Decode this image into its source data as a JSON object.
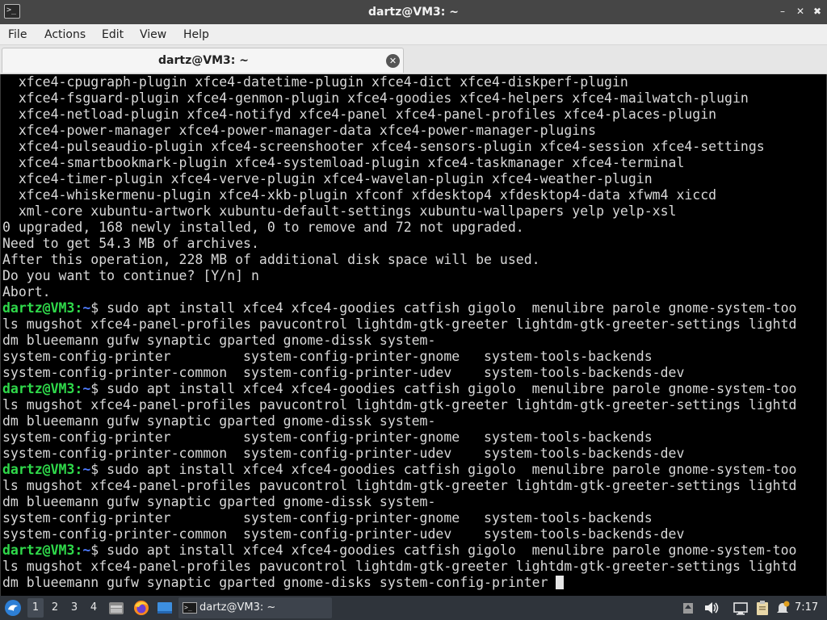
{
  "window": {
    "title": "dartz@VM3: ~"
  },
  "menubar": {
    "items": [
      "File",
      "Actions",
      "Edit",
      "View",
      "Help"
    ]
  },
  "tab": {
    "label": "dartz@VM3: ~"
  },
  "terminal": {
    "lines": [
      {
        "text": "  xfce4-cpugraph-plugin xfce4-datetime-plugin xfce4-dict xfce4-diskperf-plugin"
      },
      {
        "text": "  xfce4-fsguard-plugin xfce4-genmon-plugin xfce4-goodies xfce4-helpers xfce4-mailwatch-plugin"
      },
      {
        "text": "  xfce4-netload-plugin xfce4-notifyd xfce4-panel xfce4-panel-profiles xfce4-places-plugin"
      },
      {
        "text": "  xfce4-power-manager xfce4-power-manager-data xfce4-power-manager-plugins"
      },
      {
        "text": "  xfce4-pulseaudio-plugin xfce4-screenshooter xfce4-sensors-plugin xfce4-session xfce4-settings"
      },
      {
        "text": "  xfce4-smartbookmark-plugin xfce4-systemload-plugin xfce4-taskmanager xfce4-terminal"
      },
      {
        "text": "  xfce4-timer-plugin xfce4-verve-plugin xfce4-wavelan-plugin xfce4-weather-plugin"
      },
      {
        "text": "  xfce4-whiskermenu-plugin xfce4-xkb-plugin xfconf xfdesktop4 xfdesktop4-data xfwm4 xiccd"
      },
      {
        "text": "  xml-core xubuntu-artwork xubuntu-default-settings xubuntu-wallpapers yelp yelp-xsl"
      },
      {
        "text": "0 upgraded, 168 newly installed, 0 to remove and 72 not upgraded."
      },
      {
        "text": "Need to get 54.3 MB of archives."
      },
      {
        "text": "After this operation, 228 MB of additional disk space will be used."
      },
      {
        "text": "Do you want to continue? [Y/n] n"
      },
      {
        "text": "Abort."
      },
      {
        "user": "dartz@VM3",
        "path": "~",
        "text": " sudo apt install xfce4 xfce4-goodies catfish gigolo  menulibre parole gnome-system-too"
      },
      {
        "text": "ls mugshot xfce4-panel-profiles pavucontrol lightdm-gtk-greeter lightdm-gtk-greeter-settings lightd"
      },
      {
        "text": "dm blueemann gufw synaptic gparted gnome-dissk system-"
      },
      {
        "text": "system-config-printer         system-config-printer-gnome   system-tools-backends"
      },
      {
        "text": "system-config-printer-common  system-config-printer-udev    system-tools-backends-dev"
      },
      {
        "user": "dartz@VM3",
        "path": "~",
        "text": " sudo apt install xfce4 xfce4-goodies catfish gigolo  menulibre parole gnome-system-too"
      },
      {
        "text": "ls mugshot xfce4-panel-profiles pavucontrol lightdm-gtk-greeter lightdm-gtk-greeter-settings lightd"
      },
      {
        "text": "dm blueemann gufw synaptic gparted gnome-dissk system-"
      },
      {
        "text": "system-config-printer         system-config-printer-gnome   system-tools-backends"
      },
      {
        "text": "system-config-printer-common  system-config-printer-udev    system-tools-backends-dev"
      },
      {
        "user": "dartz@VM3",
        "path": "~",
        "text": " sudo apt install xfce4 xfce4-goodies catfish gigolo  menulibre parole gnome-system-too"
      },
      {
        "text": "ls mugshot xfce4-panel-profiles pavucontrol lightdm-gtk-greeter lightdm-gtk-greeter-settings lightd"
      },
      {
        "text": "dm blueemann gufw synaptic gparted gnome-dissk system-"
      },
      {
        "text": "system-config-printer         system-config-printer-gnome   system-tools-backends"
      },
      {
        "text": "system-config-printer-common  system-config-printer-udev    system-tools-backends-dev"
      },
      {
        "user": "dartz@VM3",
        "path": "~",
        "text": " sudo apt install xfce4 xfce4-goodies catfish gigolo  menulibre parole gnome-system-too"
      },
      {
        "text": "ls mugshot xfce4-panel-profiles pavucontrol lightdm-gtk-greeter lightdm-gtk-greeter-settings lightd"
      },
      {
        "text": "dm blueemann gufw synaptic gparted gnome-disks system-config-printer ",
        "cursor": true
      }
    ]
  },
  "taskbar": {
    "workspaces": [
      "1",
      "2",
      "3",
      "4"
    ],
    "active_workspace": "1",
    "task_label": "dartz@VM3: ~",
    "clock": "7:17",
    "icons": [
      "start-menu-icon",
      "file-manager-icon",
      "firefox-icon",
      "desktop-icon",
      "tray-up-icon",
      "volume-icon",
      "network-icon",
      "clipboard-icon",
      "notification-icon"
    ]
  },
  "colors": {
    "prompt_user": "#2fd94a",
    "prompt_path": "#4f7cff",
    "terminal_bg": "#000000",
    "terminal_fg": "#d8d8d8"
  }
}
